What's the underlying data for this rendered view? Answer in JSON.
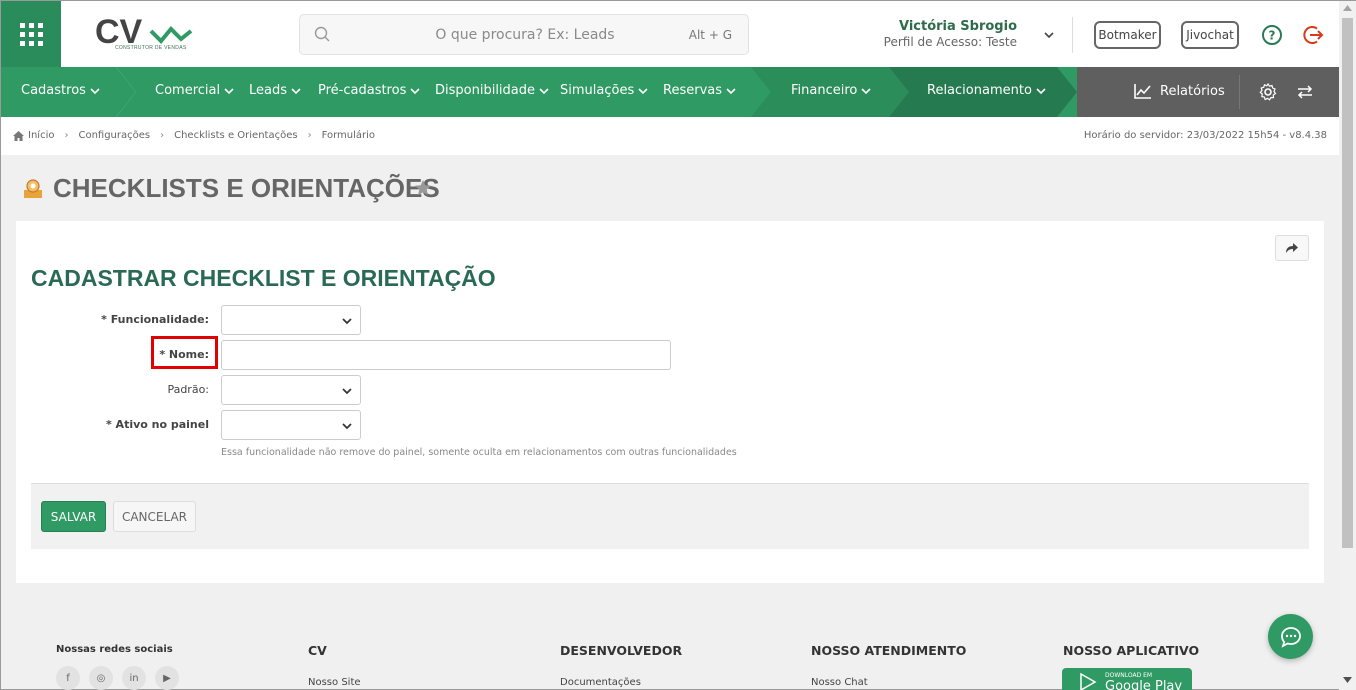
{
  "header": {
    "logo_text": "CV",
    "logo_tagline": "CONSTRUTOR DE VENDAS",
    "search_placeholder": "O que procura? Ex: Leads",
    "search_shortcut": "Alt + G",
    "user_name": "Victória Sbrogio",
    "user_role": "Perfil de Acesso: Teste",
    "botmaker_label": "Botmaker",
    "jivochat_label": "Jivochat",
    "brand_color": "#2f9a63"
  },
  "nav": {
    "items": [
      {
        "label": "Cadastros"
      },
      {
        "label": "Comercial"
      },
      {
        "label": "Leads"
      },
      {
        "label": "Pré-cadastros"
      },
      {
        "label": "Disponibilidade"
      },
      {
        "label": "Simulações"
      },
      {
        "label": "Reservas"
      },
      {
        "label": "Financeiro"
      },
      {
        "label": "Relacionamento"
      }
    ],
    "reports_label": "Relatórios"
  },
  "breadcrumb": {
    "items": [
      "Início",
      "Configurações",
      "Checklists e Orientações",
      "Formulário"
    ],
    "server_time": "Horário do servidor: 23/03/2022 15h54 - v8.4.38"
  },
  "page": {
    "title": "CHECKLISTS E ORIENTAÇÕES",
    "form_title": "CADASTRAR CHECKLIST E ORIENTAÇÃO"
  },
  "form": {
    "funcionalidade_label": "* Funcionalidade:",
    "nome_label": "* Nome:",
    "padrao_label": "Padrão:",
    "ativo_label": "* Ativo no painel",
    "ativo_hint": "Essa funcionalidade não remove do painel, somente oculta em relacionamentos com outras funcionalidades",
    "save_label": "SALVAR",
    "cancel_label": "CANCELAR"
  },
  "footer": {
    "social_title": "Nossas redes sociais",
    "social_icons": [
      "f",
      "◎",
      "in",
      "▶"
    ],
    "cv_title": "CV",
    "cv_link": "Nosso Site",
    "dev_title": "DESENVOLVEDOR",
    "dev_link": "Documentações",
    "support_title": "NOSSO ATENDIMENTO",
    "support_link": "Nosso Chat",
    "app_title": "NOSSO APLICATIVO",
    "gplay_small": "DOWNLOAD EM",
    "gplay_big": "Google Play"
  }
}
